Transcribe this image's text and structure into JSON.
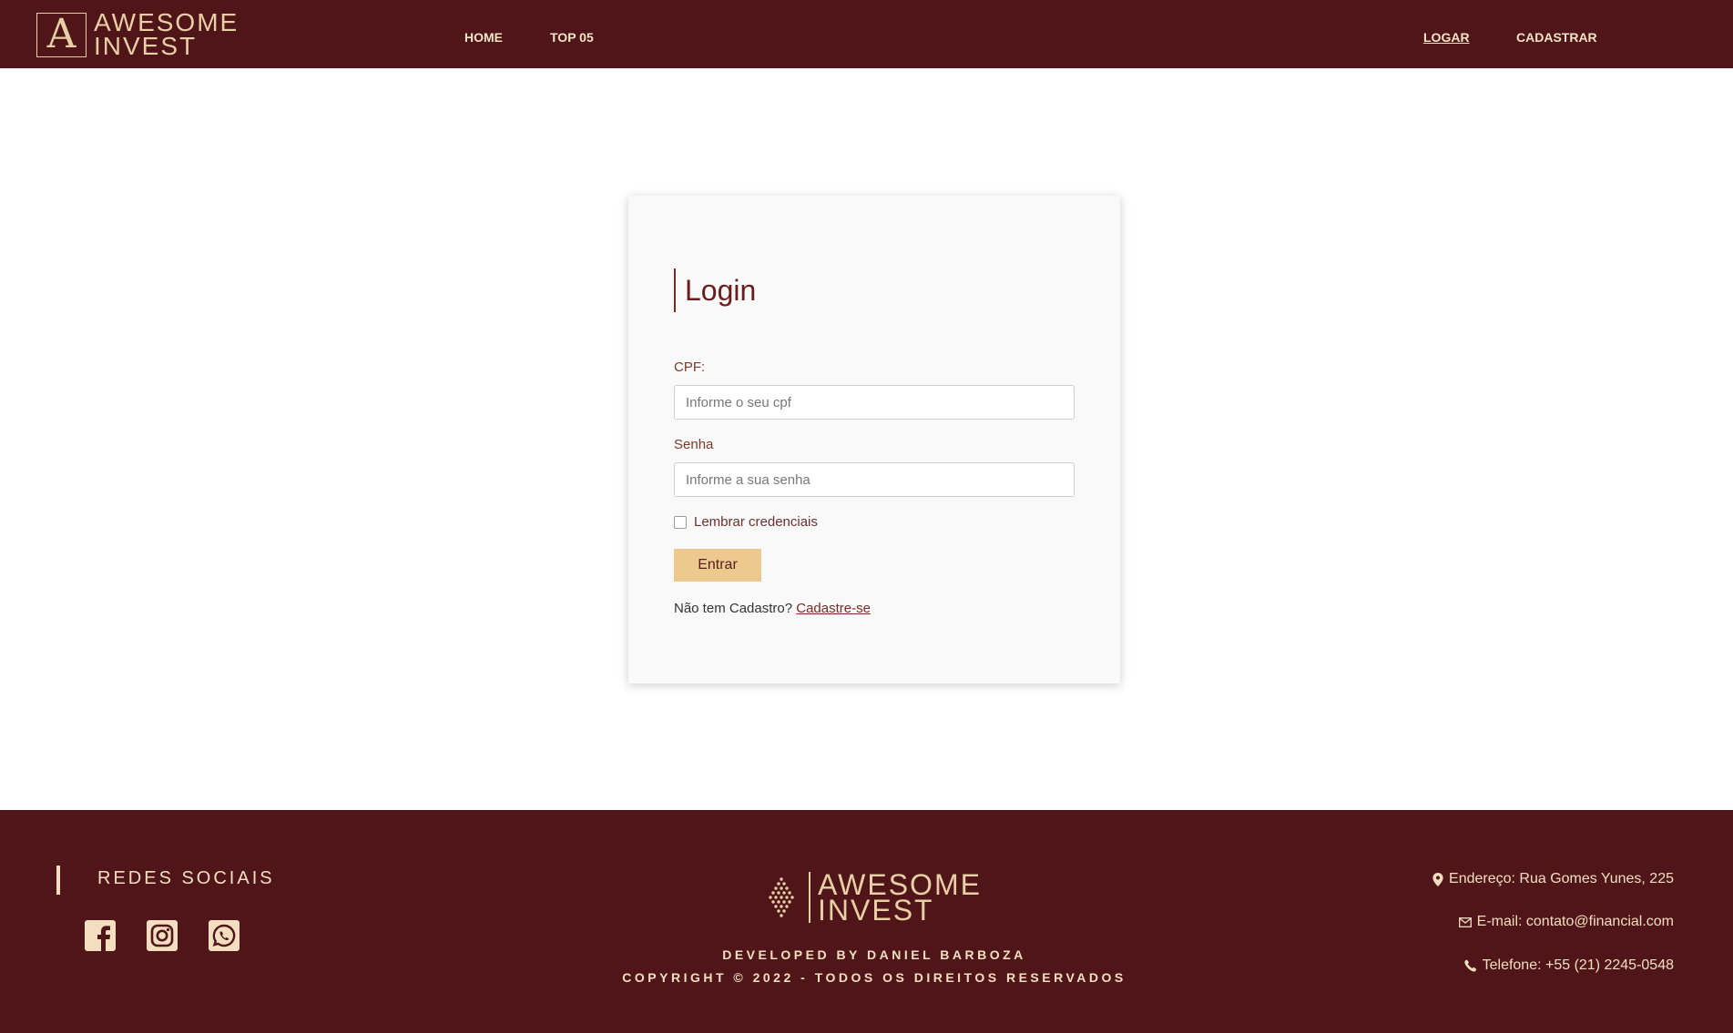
{
  "header": {
    "logo": {
      "mark": "A",
      "line1": "AWESOME",
      "line2": "INVEST"
    },
    "nav_left": [
      "HOME",
      "TOP 05"
    ],
    "nav_right": [
      "LOGAR",
      "CADASTRAR"
    ]
  },
  "login": {
    "title": "Login",
    "cpf_label": "CPF:",
    "cpf_placeholder": "Informe o seu cpf",
    "password_label": "Senha",
    "password_placeholder": "Informe a sua senha",
    "remember_label": "Lembrar credenciais",
    "submit_label": "Entrar",
    "no_account_text": "Não tem Cadastro?",
    "register_link": "Cadastre-se"
  },
  "footer": {
    "social_title": "REDES SOCIAIS",
    "social_icons": [
      "facebook-icon",
      "instagram-icon",
      "whatsapp-icon"
    ],
    "logo": {
      "line1": "AWESOME",
      "line2": "INVEST"
    },
    "developed_by": "DEVELOPED BY DANIEL BARBOZA",
    "copyright": "COPYRIGHT © 2022 - TODOS OS DIREITOS RESERVADOS",
    "address": "Endereço: Rua Gomes Yunes, 225",
    "email": "E-mail: contato@financial.com",
    "phone": "Telefone: +55 (21) 2245-0548"
  },
  "colors": {
    "brand_dark": "#501518",
    "accent_gold": "#ecca8f",
    "cream": "#f3dfc0"
  }
}
